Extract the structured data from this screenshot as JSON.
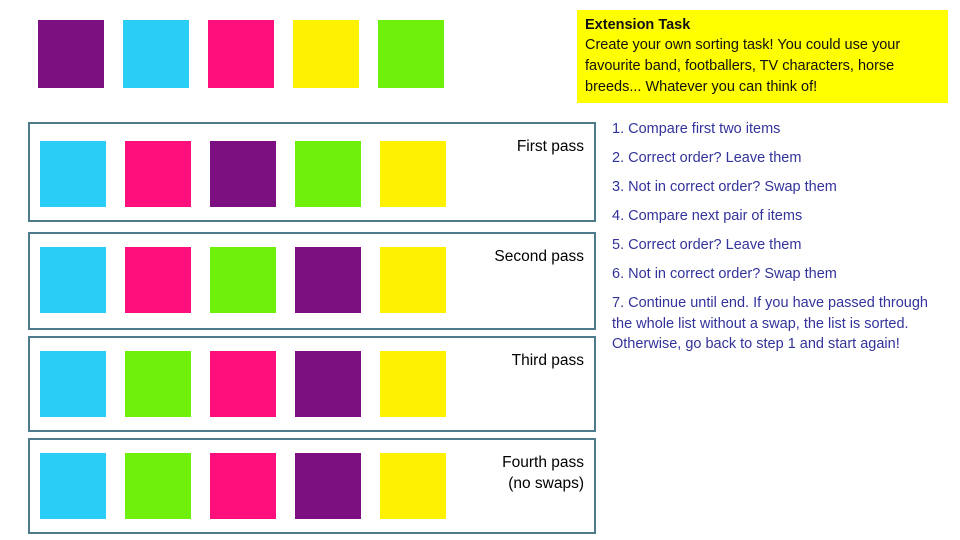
{
  "palette": {
    "purple": "#7D1080",
    "cyan": "#2ACDF5",
    "magenta": "#FF0F7B",
    "yellow": "#FFF200",
    "green": "#6EF00A",
    "panel_border": "#4F7A8C",
    "step_text": "#33339B",
    "extension_bg": "#FFFF00"
  },
  "initial_row": {
    "name": "unsorted list",
    "colors": [
      "purple",
      "cyan",
      "magenta",
      "yellow",
      "green"
    ]
  },
  "extension": {
    "title": "Extension Task",
    "body": "Create your own sorting task! You could use your favourite band, footballers, TV characters, horse breeds... Whatever you can think of!"
  },
  "passes": [
    {
      "label": "First pass",
      "colors": [
        "cyan",
        "magenta",
        "purple",
        "green",
        "yellow"
      ]
    },
    {
      "label": "Second pass",
      "colors": [
        "cyan",
        "magenta",
        "green",
        "purple",
        "yellow"
      ]
    },
    {
      "label": "Third pass",
      "colors": [
        "cyan",
        "green",
        "magenta",
        "purple",
        "yellow"
      ]
    },
    {
      "label": "Fourth pass\n(no swaps)",
      "colors": [
        "cyan",
        "green",
        "magenta",
        "purple",
        "yellow"
      ]
    }
  ],
  "steps": [
    "1. Compare first two items",
    "2. Correct order? Leave them",
    "3. Not in correct order? Swap them",
    "4. Compare next pair of items",
    "5. Correct order? Leave them",
    "6. Not in correct order? Swap them",
    "7. Continue until end. If you have passed through the whole list without a swap, the list is sorted. Otherwise, go back to step 1 and start again!"
  ]
}
